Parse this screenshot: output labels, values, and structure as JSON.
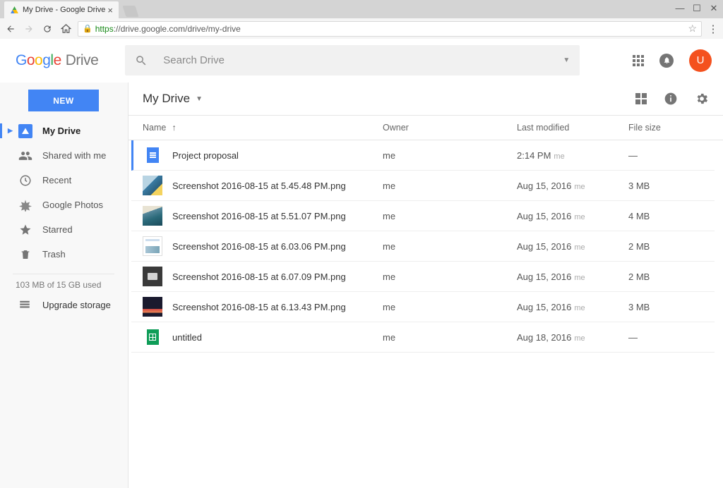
{
  "browser": {
    "tab_title": "My Drive - Google Drive",
    "url_secure": "https",
    "url_rest": "://drive.google.com/drive/my-drive"
  },
  "logo": {
    "drive": "Drive"
  },
  "search": {
    "placeholder": "Search Drive"
  },
  "avatar_letter": "U",
  "sidebar": {
    "new_label": "NEW",
    "items": [
      {
        "label": "My Drive"
      },
      {
        "label": "Shared with me"
      },
      {
        "label": "Recent"
      },
      {
        "label": "Google Photos"
      },
      {
        "label": "Starred"
      },
      {
        "label": "Trash"
      }
    ],
    "storage_text": "103 MB of 15 GB used",
    "upgrade_label": "Upgrade storage"
  },
  "toolbar": {
    "breadcrumb": "My Drive"
  },
  "columns": {
    "name": "Name",
    "owner": "Owner",
    "modified": "Last modified",
    "size": "File size"
  },
  "files": [
    {
      "name": "Project proposal",
      "owner": "me",
      "modified": "2:14 PM",
      "mod_by": "me",
      "size": "—",
      "type": "doc"
    },
    {
      "name": "Screenshot 2016-08-15 at 5.45.48 PM.png",
      "owner": "me",
      "modified": "Aug 15, 2016",
      "mod_by": "me",
      "size": "3 MB",
      "type": "img1"
    },
    {
      "name": "Screenshot 2016-08-15 at 5.51.07 PM.png",
      "owner": "me",
      "modified": "Aug 15, 2016",
      "mod_by": "me",
      "size": "4 MB",
      "type": "img2"
    },
    {
      "name": "Screenshot 2016-08-15 at 6.03.06 PM.png",
      "owner": "me",
      "modified": "Aug 15, 2016",
      "mod_by": "me",
      "size": "2 MB",
      "type": "img3"
    },
    {
      "name": "Screenshot 2016-08-15 at 6.07.09 PM.png",
      "owner": "me",
      "modified": "Aug 15, 2016",
      "mod_by": "me",
      "size": "2 MB",
      "type": "img4"
    },
    {
      "name": "Screenshot 2016-08-15 at 6.13.43 PM.png",
      "owner": "me",
      "modified": "Aug 15, 2016",
      "mod_by": "me",
      "size": "3 MB",
      "type": "img5"
    },
    {
      "name": "untitled",
      "owner": "me",
      "modified": "Aug 18, 2016",
      "mod_by": "me",
      "size": "—",
      "type": "sheet"
    }
  ]
}
